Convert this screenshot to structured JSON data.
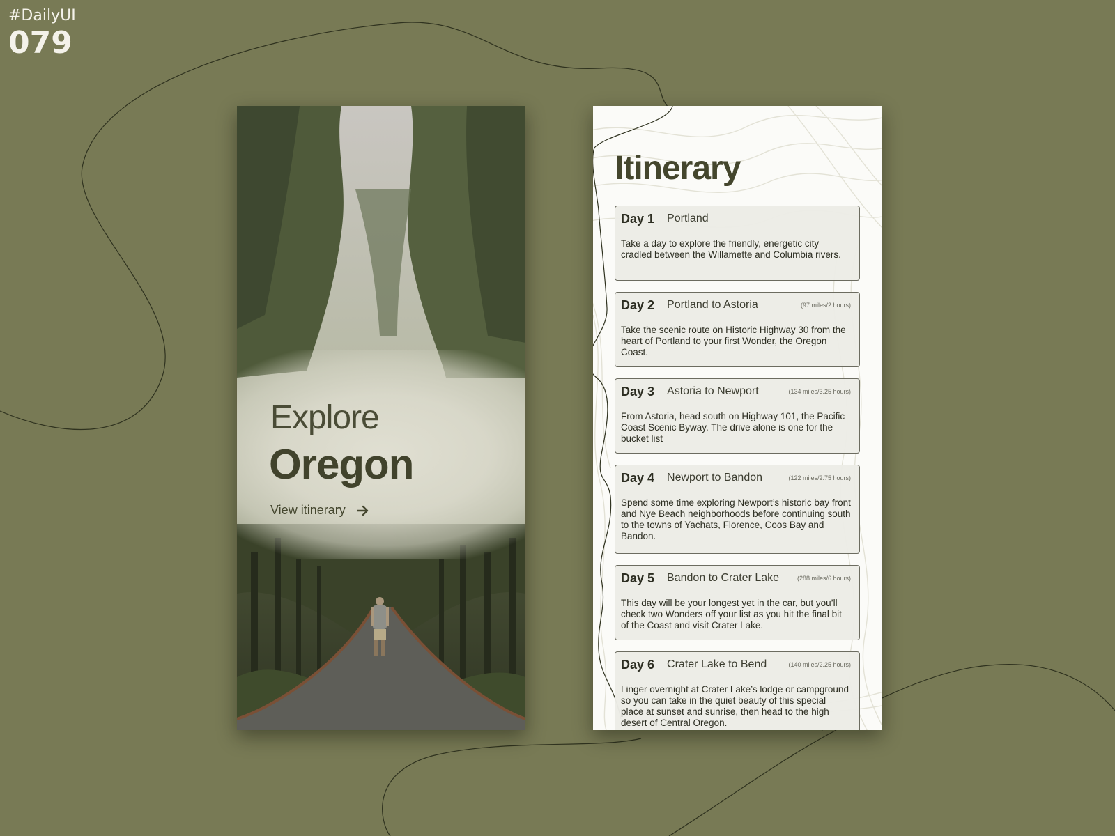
{
  "tag": {
    "hashtag": "#DailyUI",
    "number": "079"
  },
  "left_screen": {
    "title_light": "Explore",
    "title_bold": "Oregon",
    "cta_label": "View itinerary",
    "cta_icon": "arrow-right-icon"
  },
  "right_screen": {
    "title": "Itinerary",
    "days": [
      {
        "day": "Day 1",
        "route": "Portland",
        "distance": "",
        "description": "Take a day to explore the friendly, energetic city cradled between the Willamette and Columbia rivers."
      },
      {
        "day": "Day 2",
        "route": "Portland to Astoria",
        "distance": "(97 miles/2 hours)",
        "description": "Take the scenic route on Historic Highway 30 from the heart of Portland to your first Wonder, the Oregon Coast."
      },
      {
        "day": "Day 3",
        "route": "Astoria to Newport",
        "distance": "(134 miles/3.25 hours)",
        "description": "From Astoria, head south on Highway 101, the Pacific Coast Scenic Byway. The drive alone is one for the bucket list"
      },
      {
        "day": "Day 4",
        "route": "Newport to Bandon",
        "distance": "(122 miles/2.75 hours)",
        "description": "Spend some time exploring Newport’s historic bay front and Nye Beach neighborhoods before continuing south to the towns of Yachats, Florence, Coos Bay and Bandon."
      },
      {
        "day": "Day 5",
        "route": "Bandon to Crater Lake",
        "distance": "(288 miles/6 hours)",
        "description": "This day will be your longest yet in the car, but you’ll check two Wonders off your list as you hit the final bit of the Coast and visit Crater Lake."
      },
      {
        "day": "Day 6",
        "route": "Crater Lake to Bend",
        "distance": "(140 miles/2.25 hours)",
        "description": "Linger overnight at Crater Lake’s lodge or campground so you can take in the quiet beauty of this special place at sunset and sunrise, then head to the high desert of Central Oregon."
      }
    ]
  },
  "colors": {
    "background": "#787a55",
    "accent_dark": "#44462d",
    "card_bg": "#ececE6",
    "card_border": "#6c6c60"
  }
}
